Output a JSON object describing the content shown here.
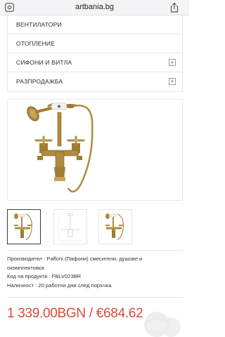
{
  "browser": {
    "domain": "artbania.bg",
    "left_icon": "reader-settings-icon",
    "right_icon": "share-icon"
  },
  "menu": {
    "items": [
      {
        "label": "ВЕНТИЛАТОРИ",
        "expandable": false
      },
      {
        "label": "ОТОПЛЕНИЕ",
        "expandable": false
      },
      {
        "label": "СИФОНИ И ВИТЛА",
        "expandable": true,
        "toggle": "+"
      },
      {
        "label": "РАЗПРОДАЖБА",
        "expandable": true,
        "toggle": "+"
      }
    ]
  },
  "product": {
    "images": {
      "main": "bath-mixer-with-hand-shower-photo",
      "thumbnails": [
        "thumbnail-bath-mixer-photo",
        "thumbnail-technical-drawing",
        "thumbnail-bath-mixer-photo-2"
      ]
    },
    "specs": {
      "manufacturer_line1": "Производител : Paffoni (Пафони) смесители, душове и",
      "manufacturer_line2": "окомплектовка",
      "code": "Код на продукта : FBLV023BR",
      "availability": "Наличност : 20 работни дни след поръчка"
    },
    "price": "1 339.00BGN / €684.62"
  },
  "colors": {
    "price": "#d94a3a",
    "bronze": "#b08a3e",
    "border": "#e4e4e4"
  }
}
